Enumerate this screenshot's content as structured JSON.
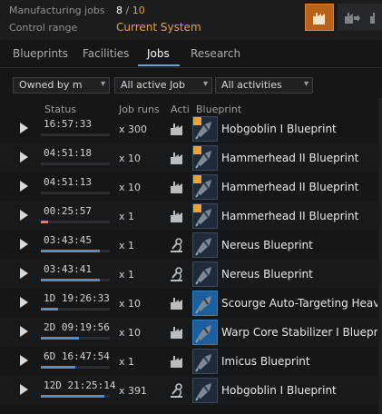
{
  "header": {
    "manufacturing_jobs_label": "Manufacturing jobs",
    "jobs_current": "8",
    "jobs_separator": "/",
    "jobs_max": "10",
    "control_range_label": "Control range",
    "control_range_value": "Current System",
    "accent_color": "#e8a23a"
  },
  "tabs": [
    {
      "label": "Blueprints"
    },
    {
      "label": "Facilities"
    },
    {
      "label": "Jobs"
    },
    {
      "label": "Research"
    }
  ],
  "filters": {
    "owner": "Owned by m",
    "jobs": "All active Job",
    "activities": "All activities"
  },
  "columns": {
    "status": "Status",
    "runs": "Job runs",
    "activity": "Acti",
    "blueprint": "Blueprint"
  },
  "jobs": [
    {
      "status": "16:57:33",
      "progress": 0.0,
      "runs": "x 300",
      "activity": "manufacturing-icon",
      "blueprint": "Hobgoblin I Blueprint",
      "bar_color": "blue"
    },
    {
      "status": "04:51:18",
      "progress": 0.0,
      "runs": "x 10",
      "activity": "manufacturing-icon",
      "blueprint": "Hammerhead II Blueprint",
      "bar_color": "blue"
    },
    {
      "status": "04:51:13",
      "progress": 0.0,
      "runs": "x 10",
      "activity": "manufacturing-icon",
      "blueprint": "Hammerhead II Blueprint",
      "bar_color": "blue"
    },
    {
      "status": "00:25:57",
      "progress": 0.1,
      "runs": "x 1",
      "activity": "manufacturing-icon",
      "blueprint": "Hammerhead II Blueprint",
      "bar_color": "orange"
    },
    {
      "status": "03:43:45",
      "progress": 0.85,
      "runs": "x 1",
      "activity": "research-icon",
      "blueprint": "Nereus Blueprint",
      "bar_color": "blue"
    },
    {
      "status": "03:43:41",
      "progress": 0.85,
      "runs": "x 1",
      "activity": "research-icon",
      "blueprint": "Nereus Blueprint",
      "bar_color": "blue"
    },
    {
      "status": "1D 19:26:33",
      "progress": 0.25,
      "runs": "x 10",
      "activity": "manufacturing-icon",
      "blueprint": "Scourge Auto-Targeting Heavy",
      "bar_color": "blue"
    },
    {
      "status": "2D 09:19:56",
      "progress": 0.55,
      "runs": "x 10",
      "activity": "manufacturing-icon",
      "blueprint": "Warp Core Stabilizer I Blueprin",
      "bar_color": "blue"
    },
    {
      "status": "6D 16:47:54",
      "progress": 0.5,
      "runs": "x 1",
      "activity": "manufacturing-icon",
      "blueprint": "Imicus Blueprint",
      "bar_color": "blue"
    },
    {
      "status": "12D 21:25:14",
      "progress": 0.92,
      "runs": "x 391",
      "activity": "research-icon",
      "blueprint": "Hobgoblin I Blueprint",
      "bar_color": "blue"
    }
  ]
}
